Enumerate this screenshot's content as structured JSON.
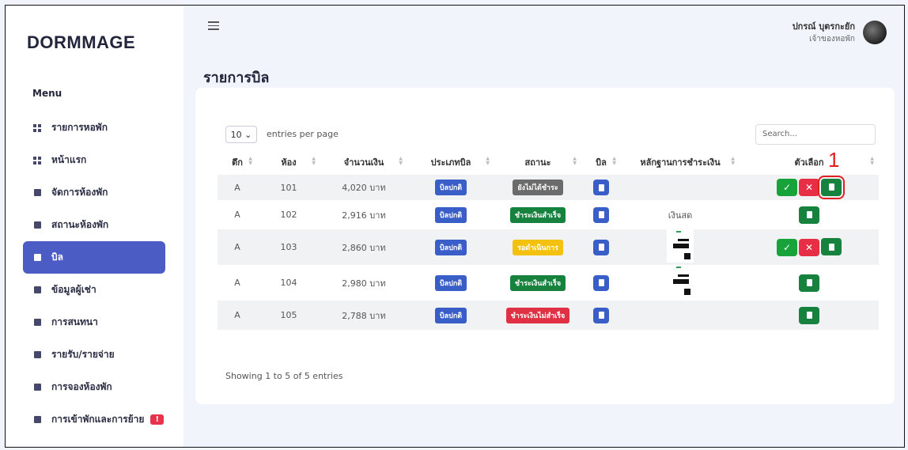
{
  "brand": "DORMMAGE",
  "menu_title": "Menu",
  "sidebar": {
    "items": [
      {
        "label": "รายการหอพัก",
        "icon": "grid-icon"
      },
      {
        "label": "หน้าแรก",
        "icon": "dashboard-icon"
      },
      {
        "label": "จัดการห้องพัก",
        "icon": "building-icon"
      },
      {
        "label": "สถานะห้องพัก",
        "icon": "building-icon"
      },
      {
        "label": "บิล",
        "icon": "receipt-icon"
      },
      {
        "label": "ข้อมูลผู้เช่า",
        "icon": "users-icon"
      },
      {
        "label": "การสนทนา",
        "icon": "chat-icon"
      },
      {
        "label": "รายรับ/รายจ่าย",
        "icon": "wallet-icon"
      },
      {
        "label": "การจองห้องพัก",
        "icon": "bookmark-icon"
      },
      {
        "label": "การเข้าพักและการย้าย",
        "icon": "move-icon",
        "badge": "!"
      }
    ],
    "active_index": 4
  },
  "header": {
    "user_name": "ปกรณ์ บุตรกะยัก",
    "user_role": "เจ้าของหอพัก"
  },
  "page_title": "รายการบิล",
  "table_controls": {
    "page_length": "10",
    "entries_label": "entries per page",
    "search_placeholder": "Search..."
  },
  "columns": [
    "ตึก",
    "ห้อง",
    "จำนวนเงิน",
    "ประเภทบิล",
    "สถานะ",
    "บิล",
    "หลักฐานการชำระเงิน",
    "ตัวเลือก"
  ],
  "rows": [
    {
      "building": "A",
      "room": "101",
      "amount": "4,020 บาท",
      "type": "บิลปกติ",
      "status": "ยังไม่ได้ชำระ",
      "status_color": "#6b6b6b",
      "proof": "",
      "proof_type": "none",
      "actions": [
        "approve",
        "reject",
        "file"
      ]
    },
    {
      "building": "A",
      "room": "102",
      "amount": "2,916 บาท",
      "type": "บิลปกติ",
      "status": "ชำระเงินสำเร็จ",
      "status_color": "#17823e",
      "proof": "เงินสด",
      "proof_type": "text",
      "actions": [
        "file"
      ]
    },
    {
      "building": "A",
      "room": "103",
      "amount": "2,860 บาท",
      "type": "บิลปกติ",
      "status": "รอดำเนินการ",
      "status_color": "#f4c10f",
      "proof": "",
      "proof_type": "image",
      "actions": [
        "approve",
        "reject",
        "file"
      ]
    },
    {
      "building": "A",
      "room": "104",
      "amount": "2,980 บาท",
      "type": "บิลปกติ",
      "status": "ชำระเงินสำเร็จ",
      "status_color": "#17823e",
      "proof": "",
      "proof_type": "image",
      "actions": [
        "file"
      ]
    },
    {
      "building": "A",
      "room": "105",
      "amount": "2,788 บาท",
      "type": "บิลปกติ",
      "status": "ชำระเงินไม่สำเร็จ",
      "status_color": "#e03144",
      "proof": "",
      "proof_type": "none",
      "actions": [
        "file"
      ]
    }
  ],
  "footer_info": "Showing 1 to 5 of 5 entries",
  "annotation_marker": "1",
  "colors": {
    "accent": "#4b5dc4",
    "approve": "#18a33a",
    "reject": "#e62f45",
    "file": "#17823e",
    "bill": "#3a5ec7"
  }
}
